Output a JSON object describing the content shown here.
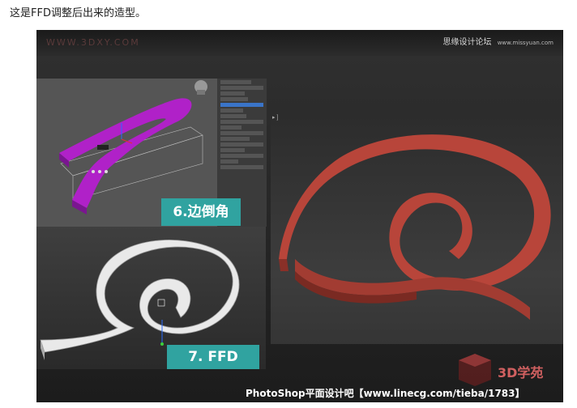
{
  "caption": "这是FFD调整后出来的造型。",
  "watermark_left": "WWW.3DXY.COM",
  "watermark_right": "思缘设计论坛",
  "watermark_right_small": "www.missyuan.com",
  "labels": {
    "edge": "6.边倒角",
    "ffd": "7. FFD"
  },
  "logo_text": "3D学苑",
  "footer": "PhotoShop平面设计吧【www.linecg.com/tieba/1783】",
  "colors": {
    "accent": "#30a3a0",
    "purple_model": "#b021c8",
    "red_model": "#b8453a"
  }
}
